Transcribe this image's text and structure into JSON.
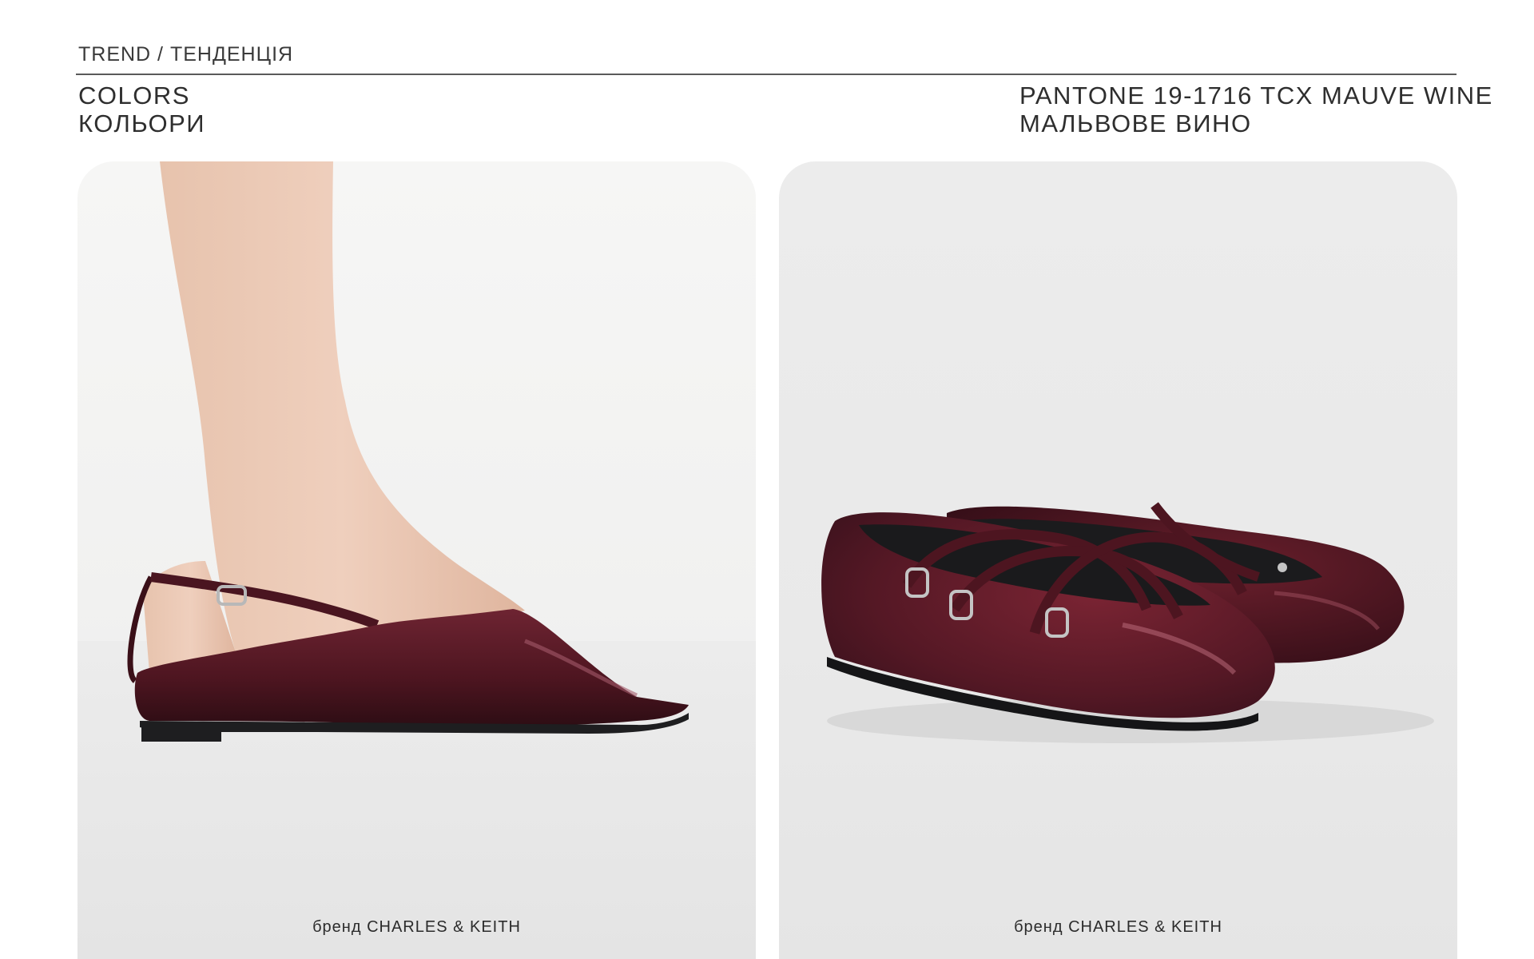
{
  "header": {
    "breadcrumb": "TREND / ТЕНДЕНЦІЯ",
    "section_title_en": "COLORS",
    "section_title_ua": "КОЛЬОРИ",
    "color_name_en": "PANTONE 19-1716 TCX MAUVE WINE",
    "color_name_ua": "МАЛЬВОВЕ ВИНО"
  },
  "products": [
    {
      "image": "slingback-pointed-flat-photo",
      "caption": "бренд CHARLES & KEITH"
    },
    {
      "image": "mary-jane-strap-flats-photo",
      "caption": "бренд CHARLES & KEITH"
    }
  ],
  "colors": {
    "accent_wine": "#5a1a24",
    "background": "#ffffff",
    "card_bg": "#eeeeee"
  }
}
